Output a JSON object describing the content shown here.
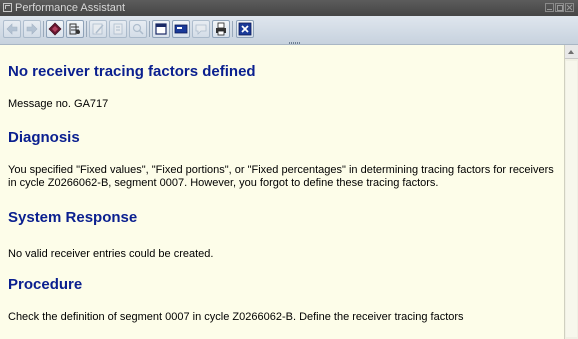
{
  "window": {
    "title": "Performance Assistant",
    "controls": [
      "minimize-icon",
      "maximize-icon",
      "close-icon"
    ]
  },
  "toolbar": {
    "buttons": [
      {
        "icon": "back-arrow-icon",
        "enabled": false
      },
      {
        "icon": "forward-arrow-icon",
        "enabled": false
      },
      {
        "icon": "book-icon",
        "enabled": true
      },
      {
        "icon": "technical-info-icon",
        "enabled": true
      },
      {
        "icon": "edit-icon",
        "enabled": false
      },
      {
        "icon": "document-icon",
        "enabled": false
      },
      {
        "icon": "search-icon",
        "enabled": false
      },
      {
        "icon": "window-icon",
        "enabled": true
      },
      {
        "icon": "keyboard-icon",
        "enabled": true
      },
      {
        "icon": "speech-icon",
        "enabled": false
      },
      {
        "icon": "print-icon",
        "enabled": true
      },
      {
        "icon": "close-x-icon",
        "enabled": true
      }
    ]
  },
  "message": {
    "title": "No receiver tracing factors defined",
    "message_no": "Message no. GA717",
    "sections": [
      {
        "heading": "Diagnosis",
        "text": "You specified \"Fixed values\", \"Fixed portions\", or \"Fixed percentages\" in determining tracing factors for receivers in cycle Z0266062-B, segment 0007. However, you forgot to define these tracing factors."
      },
      {
        "heading": "System Response",
        "text": "No valid receiver entries could be created."
      },
      {
        "heading": "Procedure",
        "text": "Check the definition of segment 0007 in cycle Z0266062-B. Define the receiver tracing factors"
      }
    ]
  },
  "colors": {
    "heading": "#0a1f8f",
    "background": "#fdfde9"
  }
}
